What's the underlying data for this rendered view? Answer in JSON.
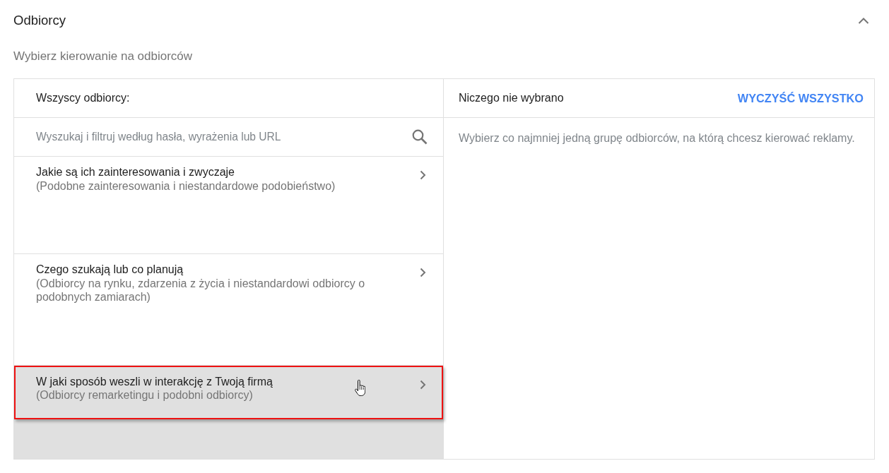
{
  "section": {
    "title": "Odbiorcy",
    "expanded": true
  },
  "subtitle": "Wybierz kierowanie na odbiorców",
  "browse_panel": {
    "heading": "Wszyscy odbiorcy:",
    "search": {
      "placeholder": "Wyszukaj i filtruj według hasła, wyrażenia lub URL"
    },
    "categories": [
      {
        "title": "Jakie są ich zainteresowania i zwyczaje",
        "description": "(Podobne zainteresowania i niestandardowe podobieństwo)",
        "hovered": false
      },
      {
        "title": "Czego szukają lub co planują",
        "description": "(Odbiorcy na rynku, zdarzenia z życia i niestandardowi odbiorcy o podobnych zamiarach)",
        "hovered": false
      },
      {
        "title": "W jaki sposób weszli w interakcję z Twoją firmą",
        "description": "(Odbiorcy remarketingu i podobni odbiorcy)",
        "hovered": true
      }
    ]
  },
  "selection_panel": {
    "heading": "Niczego nie wybrano",
    "clear_button": "WYCZYŚĆ WSZYSTKO",
    "empty_message": "Wybierz co najmniej jedną grupę odbiorców, na którą chcesz kierować reklamy."
  }
}
